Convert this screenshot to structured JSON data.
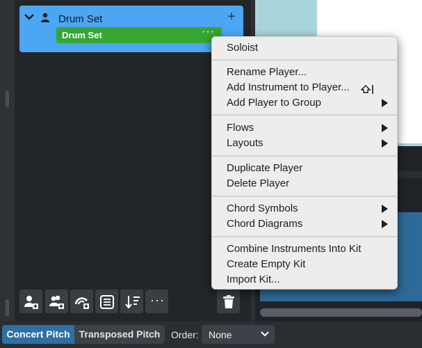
{
  "player": {
    "name": "Drum Set",
    "instrument": "Drum Set",
    "more_glyph": "···",
    "add_glyph": "+"
  },
  "toolbar": {
    "icons": [
      "add-solo-player-icon",
      "add-ensemble-icon",
      "add-section-player-icon",
      "text-list-icon",
      "sort-order-icon",
      "more-options-icon",
      "delete-trash-icon"
    ],
    "more_glyph": "···"
  },
  "context_menu": {
    "groups": [
      [
        {
          "label": "Soloist"
        }
      ],
      [
        {
          "label": "Rename Player..."
        },
        {
          "label": "Add Instrument to Player..."
        },
        {
          "label": "Add Player to Group",
          "submenu": true
        }
      ],
      [
        {
          "label": "Flows",
          "submenu": true
        },
        {
          "label": "Layouts",
          "submenu": true
        }
      ],
      [
        {
          "label": "Duplicate Player"
        },
        {
          "label": "Delete Player"
        }
      ],
      [
        {
          "label": "Chord Symbols",
          "submenu": true
        },
        {
          "label": "Chord Diagrams",
          "submenu": true
        }
      ],
      [
        {
          "label": "Combine Instruments Into Kit"
        },
        {
          "label": "Create Empty Kit"
        },
        {
          "label": "Import Kit..."
        }
      ]
    ]
  },
  "status_bar": {
    "concert_pitch": "Concert Pitch",
    "transposed_pitch": "Transposed Pitch",
    "order_label": "Order:",
    "order_value": "None"
  },
  "colors": {
    "player_card": "#4da6f3",
    "instrument_row": "#36a732",
    "concert_active": "#2f6fa1",
    "menu_bg": "#ededed"
  }
}
